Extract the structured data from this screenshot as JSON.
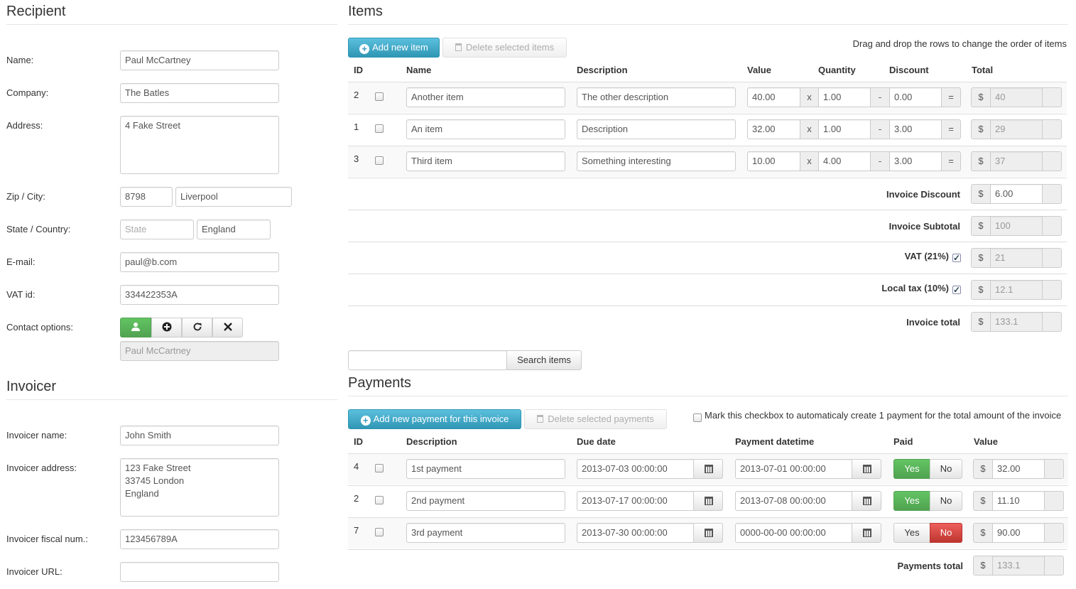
{
  "recipient": {
    "title": "Recipient",
    "name_label": "Name:",
    "name": "Paul McCartney",
    "company_label": "Company:",
    "company": "The Batles",
    "address_label": "Address:",
    "address": "4 Fake Street",
    "zip_label": "Zip / City:",
    "zip": "8798",
    "city": "Liverpool",
    "state_label": "State / Country:",
    "state_placeholder": "State",
    "country": "England",
    "email_label": "E-mail:",
    "email": "paul@b.com",
    "vat_label": "VAT id:",
    "vat": "334422353A",
    "contact_label": "Contact options:",
    "contact_icons": [
      "user-icon",
      "plus-circle-icon",
      "refresh-icon",
      "close-icon"
    ],
    "contact_value": "Paul McCartney"
  },
  "invoicer": {
    "title": "Invoicer",
    "name_label": "Invoicer name:",
    "name": "John Smith",
    "address_label": "Invoicer address:",
    "address": "123 Fake Street\n33745 London\nEngland",
    "fiscal_label": "Invoicer fiscal num.:",
    "fiscal": "123456789A",
    "url_label": "Invoicer URL:",
    "url": ""
  },
  "items": {
    "title": "Items",
    "add_label": "Add new item",
    "delete_label": "Delete selected items",
    "hint": "Drag and drop the rows to change the order of items",
    "headers": {
      "id": "ID",
      "name": "Name",
      "description": "Description",
      "value": "Value",
      "quantity": "Quantity",
      "discount": "Discount",
      "total": "Total"
    },
    "ops": {
      "x": "x",
      "minus": "-",
      "eq": "=",
      "currency": "$"
    },
    "rows": [
      {
        "id": "2",
        "name": "Another item",
        "description": "The other description",
        "value": "40.00",
        "quantity": "1.00",
        "discount": "0.00",
        "total": "40"
      },
      {
        "id": "1",
        "name": "An item",
        "description": "Description",
        "value": "32.00",
        "quantity": "1.00",
        "discount": "3.00",
        "total": "29"
      },
      {
        "id": "3",
        "name": "Third item",
        "description": "Something interesting",
        "value": "10.00",
        "quantity": "4.00",
        "discount": "3.00",
        "total": "37"
      }
    ],
    "invoice_discount_label": "Invoice Discount",
    "invoice_discount": "6.00",
    "subtotal_label": "Invoice Subtotal",
    "subtotal": "100",
    "vat_label": "VAT (21%)",
    "vat": "21",
    "local_tax_label": "Local tax (10%)",
    "local_tax": "12.1",
    "total_label": "Invoice total",
    "total": "133.1",
    "search_value": "",
    "search_label": "Search items"
  },
  "payments": {
    "title": "Payments",
    "add_label": "Add new payment for this invoice",
    "delete_label": "Delete selected payments",
    "auto_label": "Mark this checkbox to automaticaly create 1 payment for the total amount of the invoice",
    "headers": {
      "id": "ID",
      "description": "Description",
      "due": "Due date",
      "datetime": "Payment datetime",
      "paid": "Paid",
      "value": "Value"
    },
    "yes": "Yes",
    "no": "No",
    "currency": "$",
    "rows": [
      {
        "id": "4",
        "description": "1st payment",
        "due": "2013-07-03 00:00:00",
        "datetime": "2013-07-01 00:00:00",
        "paid": "yes",
        "value": "32.00"
      },
      {
        "id": "2",
        "description": "2nd payment",
        "due": "2013-07-17 00:00:00",
        "datetime": "2013-07-08 00:00:00",
        "paid": "yes",
        "value": "11.10"
      },
      {
        "id": "7",
        "description": "3rd payment",
        "due": "2013-07-30 00:00:00",
        "datetime": "0000-00-00 00:00:00",
        "paid": "no",
        "value": "90.00"
      }
    ],
    "total_label": "Payments total",
    "total": "133.1"
  },
  "colors": {
    "accent": "#49afcd",
    "success": "#5bb75b",
    "danger": "#da4f49"
  }
}
